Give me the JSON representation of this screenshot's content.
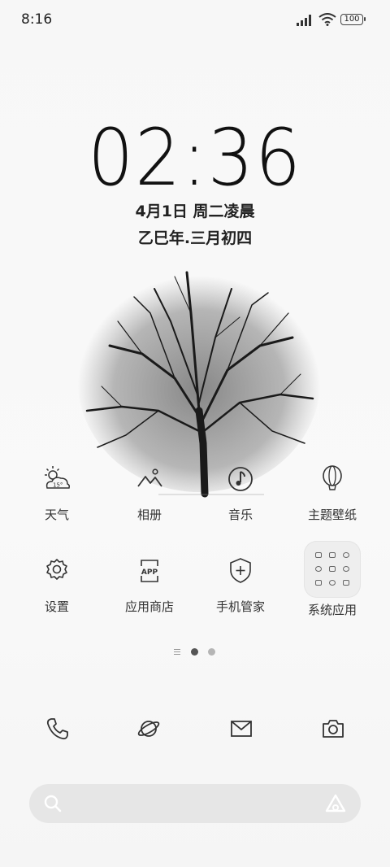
{
  "status_bar": {
    "time": "8:16",
    "battery": "100"
  },
  "lockscreen": {
    "clock": "02:36",
    "date": "4月1日 周二凌晨",
    "lunar_date": "乙巳年.三月初四"
  },
  "apps_row1": [
    {
      "label": "天气",
      "icon": "weather-icon",
      "temp": "15°"
    },
    {
      "label": "相册",
      "icon": "gallery-icon"
    },
    {
      "label": "音乐",
      "icon": "music-icon"
    },
    {
      "label": "主题壁纸",
      "icon": "theme-balloon-icon"
    }
  ],
  "apps_row2": [
    {
      "label": "设置",
      "icon": "settings-gear-icon"
    },
    {
      "label": "应用商店",
      "icon": "app-store-icon",
      "badge_text": "APP"
    },
    {
      "label": "手机管家",
      "icon": "shield-plus-icon"
    },
    {
      "label": "系统应用",
      "icon": "folder-icon"
    }
  ],
  "dock": [
    {
      "name": "phone",
      "icon": "phone-icon"
    },
    {
      "name": "browser",
      "icon": "browser-planet-icon"
    },
    {
      "name": "messages",
      "icon": "mail-icon"
    },
    {
      "name": "camera",
      "icon": "camera-icon"
    }
  ],
  "search_bar": {
    "icon": "search-icon",
    "assistant_icon": "assistant-icon"
  },
  "page_indicator": {
    "pages": 2,
    "current": 1
  }
}
